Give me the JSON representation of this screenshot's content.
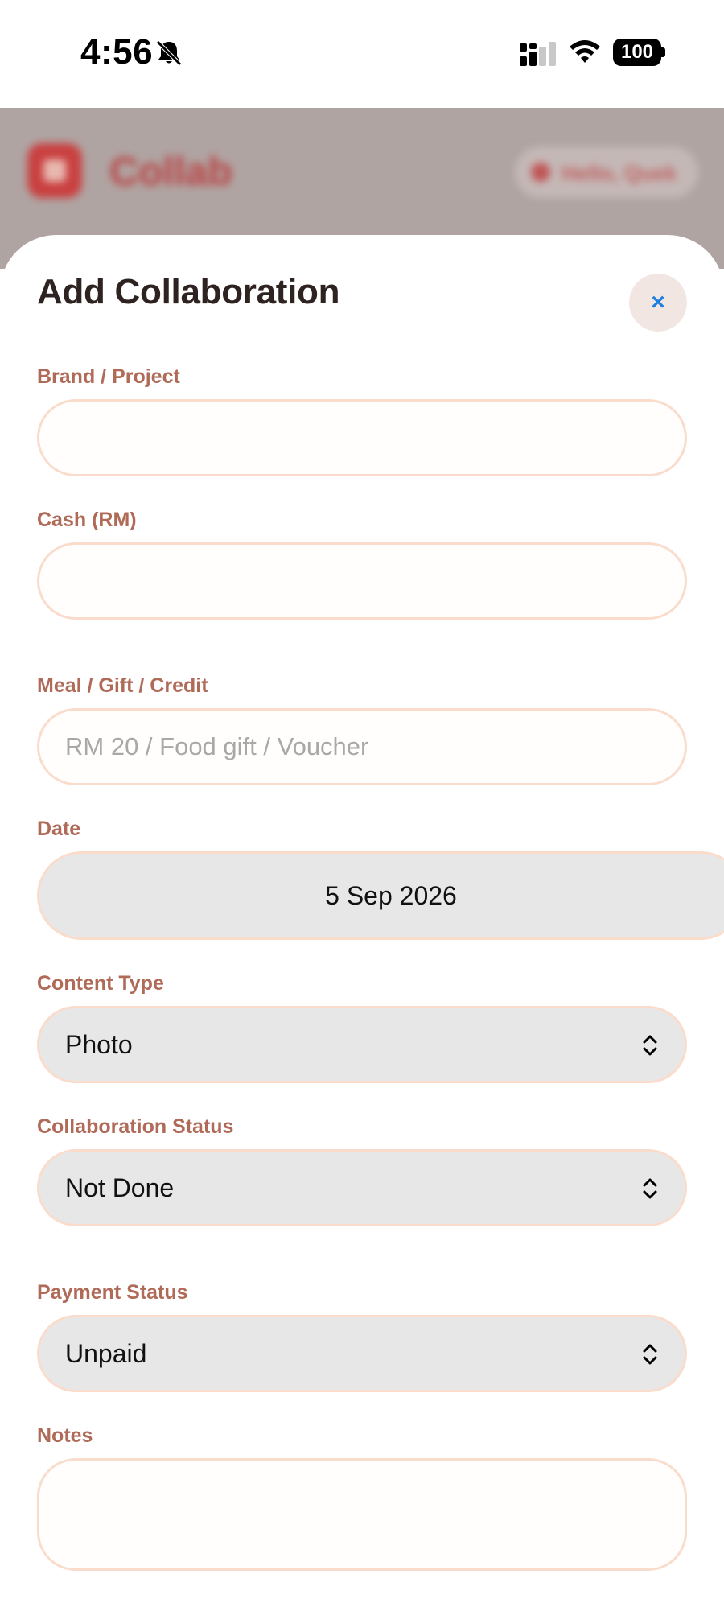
{
  "status_bar": {
    "time": "4:56",
    "battery": "100"
  },
  "backdrop": {
    "app_title": "Collab",
    "greeting": "Hello, Quek"
  },
  "sheet": {
    "title": "Add Collaboration",
    "close_label": "×",
    "fields": {
      "brand": {
        "label": "Brand / Project",
        "value": "",
        "placeholder": ""
      },
      "cash": {
        "label": "Cash (RM)",
        "value": "",
        "placeholder": ""
      },
      "meal": {
        "label": "Meal / Gift / Credit",
        "value": "",
        "placeholder": "RM 20 / Food gift / Voucher"
      },
      "date": {
        "label": "Date",
        "value": "5 Sep 2026"
      },
      "content_type": {
        "label": "Content Type",
        "value": "Photo"
      },
      "collab_status": {
        "label": "Collaboration Status",
        "value": "Not Done"
      },
      "payment_status": {
        "label": "Payment Status",
        "value": "Unpaid"
      },
      "notes": {
        "label": "Notes",
        "value": ""
      }
    }
  },
  "icons": {
    "bell": "bell-slash-icon",
    "signal": "cellular-signal-icon",
    "wifi": "wifi-icon",
    "close": "close-icon",
    "chevron": "chevron-up-down-icon"
  },
  "colors": {
    "label": "#b06a58",
    "input_border": "#fadccd",
    "select_bg": "#e8e7e7",
    "close_icon": "#1f7fe0",
    "backdrop": "#b0a4a2"
  }
}
